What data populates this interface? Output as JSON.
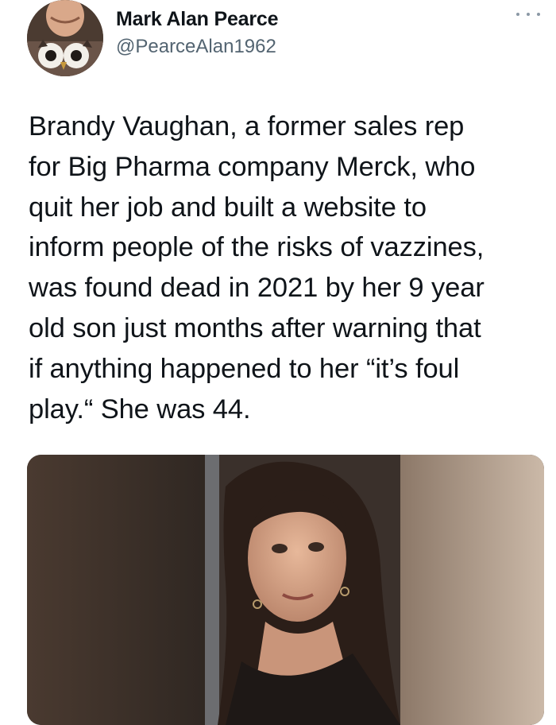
{
  "author": {
    "name": "Mark Alan Pearce",
    "handle": "@PearceAlan1962"
  },
  "icons": {
    "more": "more-horizontal-icon"
  },
  "tweet": {
    "lines": [
      "Brandy Vaughan, a former sales rep",
      "for Big Pharma company Merck, who",
      "quit her job and built a website to",
      "inform people of the risks of vazzines,",
      "was found dead in 2021 by her 9 year",
      "old son just months after warning that",
      "if anything happened to her “it’s foul",
      "play.“ She was 44."
    ]
  },
  "colors": {
    "text": "#0f1419",
    "secondary": "#536471"
  }
}
